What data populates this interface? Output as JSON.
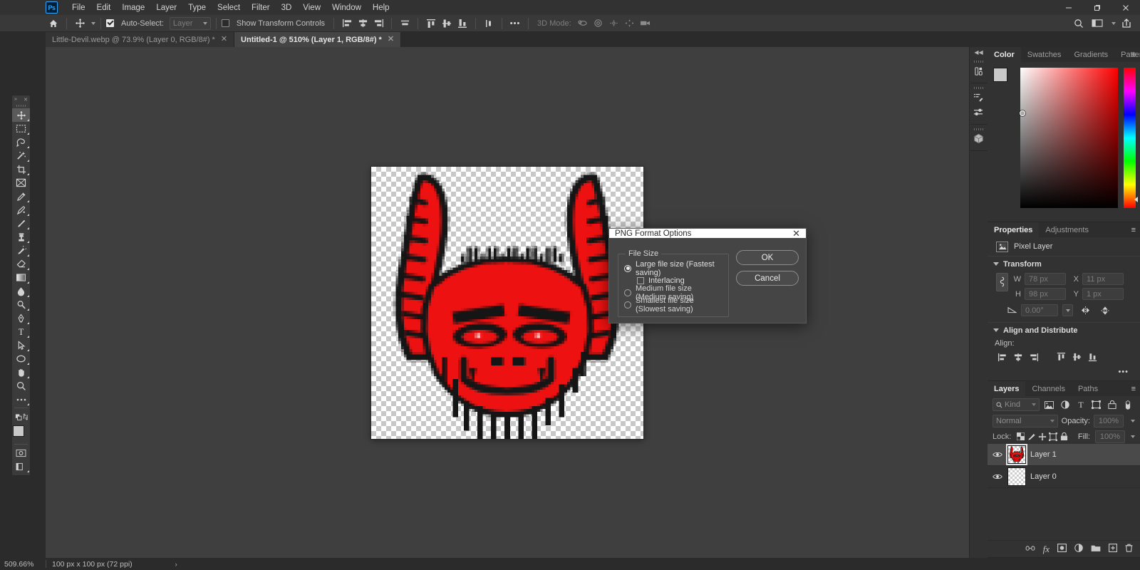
{
  "app": {
    "logo": "Ps",
    "menus": [
      "File",
      "Edit",
      "Image",
      "Layer",
      "Type",
      "Select",
      "Filter",
      "3D",
      "View",
      "Window",
      "Help"
    ],
    "window_controls": {
      "minimize": "–",
      "maximize": "❐",
      "close": "✕"
    }
  },
  "options_bar": {
    "home_icon": "home-icon",
    "tool_icon": "move-tool-icon",
    "auto_select_label": "Auto-Select:",
    "auto_select_checked": true,
    "layer_dropdown_value": "Layer",
    "show_transform_label": "Show Transform Controls",
    "show_transform_checked": false,
    "three_d_mode_label": "3D Mode:",
    "more_label": "•••",
    "right_icons": [
      "search-icon",
      "workspace-icon",
      "share-icon"
    ]
  },
  "tabs": [
    {
      "title": "Little-Devil.webp @ 73.9% (Layer 0, RGB/8#) *",
      "active": false,
      "close": "✕"
    },
    {
      "title": "Untitled-1 @ 510% (Layer 1, RGB/8#) *",
      "active": true,
      "close": "✕"
    }
  ],
  "toolbar": {
    "expand": "»",
    "close": "✕",
    "tools": [
      {
        "name": "move-tool",
        "selected": true
      },
      {
        "name": "rectangular-marquee-tool",
        "selected": false
      },
      {
        "name": "lasso-tool",
        "selected": false
      },
      {
        "name": "magic-wand-tool",
        "selected": false
      },
      {
        "name": "crop-tool",
        "selected": false
      },
      {
        "name": "frame-tool",
        "selected": false
      },
      {
        "name": "eyedropper-tool",
        "selected": false
      },
      {
        "name": "spot-healing-brush-tool",
        "selected": false
      },
      {
        "name": "brush-tool",
        "selected": false
      },
      {
        "name": "clone-stamp-tool",
        "selected": false
      },
      {
        "name": "history-brush-tool",
        "selected": false
      },
      {
        "name": "eraser-tool",
        "selected": false
      },
      {
        "name": "gradient-tool",
        "selected": false
      },
      {
        "name": "blur-tool",
        "selected": false
      },
      {
        "name": "dodge-tool",
        "selected": false
      },
      {
        "name": "pen-tool",
        "selected": false
      },
      {
        "name": "type-tool",
        "selected": false
      },
      {
        "name": "path-selection-tool",
        "selected": false
      },
      {
        "name": "ellipse-tool",
        "selected": false
      },
      {
        "name": "hand-tool",
        "selected": false
      },
      {
        "name": "zoom-tool",
        "selected": false
      },
      {
        "name": "edit-toolbar",
        "selected": false
      }
    ],
    "foreground_color": "#c9c9c9",
    "background_color": "#f0a30a",
    "quick_mask": "quick-mask-icon",
    "screen_mode": "screen-mode-icon"
  },
  "color_panel": {
    "tabs": [
      "Color",
      "Swatches",
      "Gradients",
      "Patterns"
    ],
    "active_tab": "Color",
    "menu": "≡",
    "foreground_color": "#c9c9c9",
    "background_color": "#f0a30a",
    "ramp_color": "#ff0000"
  },
  "properties_panel": {
    "tabs": [
      "Properties",
      "Adjustments"
    ],
    "active_tab": "Properties",
    "menu": "≡",
    "layer_type": "Pixel Layer",
    "transform": {
      "title": "Transform",
      "w_label": "W",
      "w_value": "78 px",
      "h_label": "H",
      "h_value": "98 px",
      "x_label": "X",
      "x_value": "11 px",
      "y_label": "Y",
      "y_value": "1 px",
      "angle_value": "0.00°",
      "link_icon": "link-icon",
      "flip_horizontal_icon": "flip-horizontal-icon",
      "flip_vertical_icon": "flip-vertical-icon"
    },
    "align": {
      "title": "Align and Distribute",
      "label": "Align:",
      "buttons": [
        "align-left",
        "align-center-horizontal",
        "align-right",
        "align-top",
        "align-middle-vertical",
        "align-bottom"
      ],
      "more": "•••"
    }
  },
  "layers_panel": {
    "tabs": [
      "Layers",
      "Channels",
      "Paths"
    ],
    "active_tab": "Layers",
    "menu": "≡",
    "filter_placeholder": "Kind",
    "filter_icons": [
      "pixel-filter-icon",
      "adjustment-filter-icon",
      "type-filter-icon",
      "shape-filter-icon",
      "smart-object-filter-icon",
      "filter-toggle-icon"
    ],
    "blend_mode": "Normal",
    "opacity_label": "Opacity:",
    "opacity_value": "100%",
    "lock_label": "Lock:",
    "lock_icons": [
      "lock-transparent-pixels-icon",
      "lock-image-pixels-icon",
      "lock-position-icon",
      "lock-artboard-icon",
      "lock-all-icon"
    ],
    "fill_label": "Fill:",
    "fill_value": "100%",
    "layers": [
      {
        "name": "Layer 1",
        "visible": true,
        "active": true,
        "thumb": "demon",
        "eye": "eye-icon"
      },
      {
        "name": "Layer 0",
        "visible": true,
        "active": false,
        "thumb": "empty",
        "eye": "eye-icon"
      }
    ],
    "footer_icons": [
      "link-layers-icon",
      "layer-style-icon",
      "layer-mask-icon",
      "adjustment-layer-icon",
      "new-group-icon",
      "new-layer-icon",
      "delete-layer-icon"
    ]
  },
  "status_bar": {
    "zoom": "509.66%",
    "doc_info": "100 px x 100 px (72 ppi)",
    "arrow": "›"
  },
  "dialog": {
    "title": "PNG Format Options",
    "close": "✕",
    "fieldset_legend": "File Size",
    "options": [
      {
        "label": "Large file size (Fastest saving)",
        "selected": true
      },
      {
        "label": "Medium file size (Medium saving)",
        "selected": false
      },
      {
        "label": "Smallest file size (Slowest saving)",
        "selected": false
      }
    ],
    "interlacing_label": "Interlacing",
    "interlacing_checked": false,
    "ok_label": "OK",
    "cancel_label": "Cancel"
  },
  "artwork": {
    "description": "red-demon-oni-mask",
    "primary_color": "#ee1111",
    "outline_color": "#151515"
  }
}
